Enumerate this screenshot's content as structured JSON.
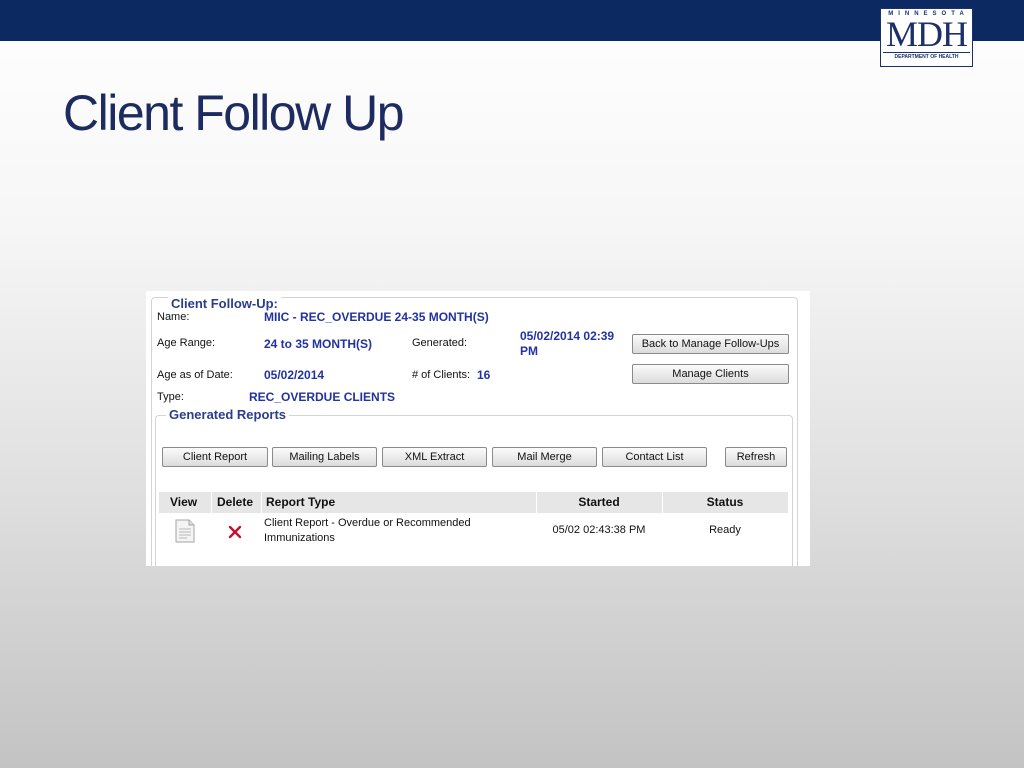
{
  "slide": {
    "title": "Client Follow Up",
    "logo": {
      "top_text": "MINNESOTA",
      "main_text": "MDH",
      "bottom_text": "DEPARTMENT OF HEALTH"
    }
  },
  "follow_up": {
    "legend": "Client Follow-Up:",
    "name_label": "Name:",
    "name_value": "MIIC - REC_OVERDUE 24-35 MONTH(S)",
    "age_range_label": "Age Range:",
    "age_range_value": "24 to 35 MONTH(S)",
    "generated_label": "Generated:",
    "generated_value_line1": "05/02/2014 02:39",
    "generated_value_line2": "PM",
    "age_as_of_label": "Age as of Date:",
    "age_as_of_value": "05/02/2014",
    "num_clients_label": "# of Clients:",
    "num_clients_value": "16",
    "type_label": "Type:",
    "type_value": "REC_OVERDUE CLIENTS",
    "back_button": "Back to Manage Follow-Ups",
    "manage_clients_button": "Manage Clients"
  },
  "reports": {
    "legend": "Generated Reports",
    "buttons": {
      "client_report": "Client Report",
      "mailing_labels": "Mailing Labels",
      "xml_extract": "XML Extract",
      "mail_merge": "Mail Merge",
      "contact_list": "Contact List",
      "refresh": "Refresh"
    },
    "columns": {
      "view": "View",
      "delete": "Delete",
      "report_type": "Report Type",
      "started": "Started",
      "status": "Status"
    },
    "rows": [
      {
        "report_type_line1": "Client Report - Overdue or Recommended",
        "report_type_line2": "Immunizations",
        "started": "05/02 02:43:38 PM",
        "status": "Ready",
        "view_icon": "document-icon",
        "delete_icon": "delete-x-icon"
      }
    ]
  },
  "colors": {
    "header_bar": "#0c2a61",
    "title_text": "#1d2b61",
    "legend_text": "#2b3e8c",
    "value_text": "#2233a0",
    "delete_icon": "#c8102e"
  }
}
